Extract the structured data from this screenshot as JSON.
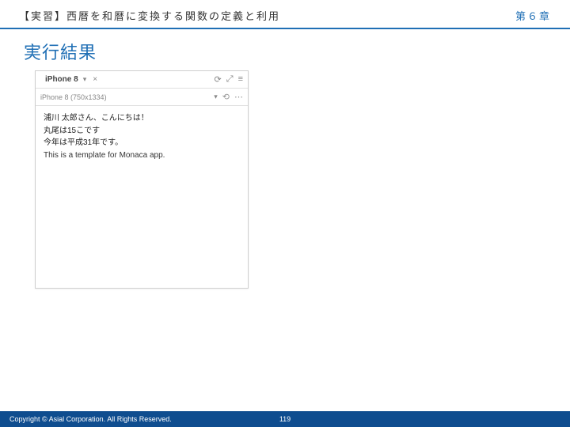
{
  "header": {
    "title": "【実習】西暦を和暦に変換する関数の定義と利用",
    "chapter": "第６章"
  },
  "section_title": "実行結果",
  "sim": {
    "device_label": "iPhone 8",
    "close_glyph": "×",
    "reload_glyph": "⟳",
    "expand_glyph": "⤢",
    "menu_glyph": "≡",
    "resolution": "iPhone 8 (750x1334)",
    "dropdown_glyph": "▾",
    "rotate_glyph": "⟲",
    "more_glyph": "⋯",
    "body_lines": [
      "浦川 太郎さん、こんにちは！",
      "丸尾は15こです",
      "今年は平成31年です。",
      "This is a template for Monaca app."
    ]
  },
  "footer": {
    "copyright": "Copyright ©  Asial Corporation. All Rights Reserved.",
    "page": "119"
  }
}
